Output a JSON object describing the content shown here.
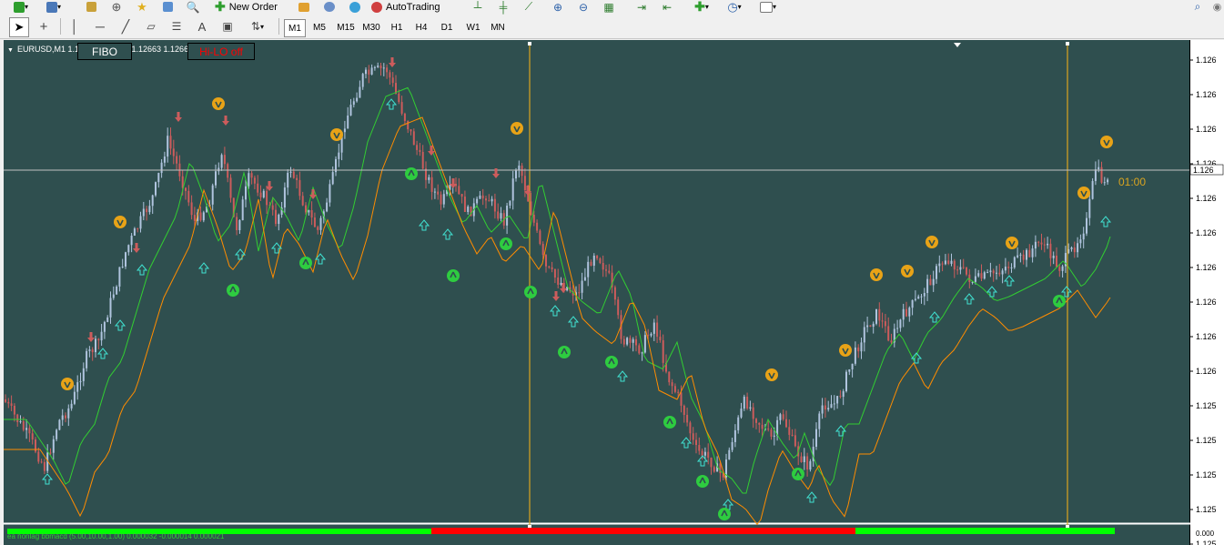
{
  "toolbar_top": {
    "new_order_label": "New Order",
    "autotrading_label": "AutoTrading"
  },
  "timeframes": [
    "M1",
    "M5",
    "M15",
    "M30",
    "H1",
    "H4",
    "D1",
    "W1",
    "MN"
  ],
  "active_timeframe": "M1",
  "chart": {
    "symbol_info": "EURUSD,M1  1.12663 1.12663 1.12663 1.12663",
    "fibo_label": "FIBO",
    "hilo_label": "Hi-LO off",
    "timer_label": "01:00",
    "current_price_label": "1.126",
    "price_axis_labels": [
      "1.126",
      "1.126",
      "1.126",
      "1.126",
      "1.126",
      "1.126",
      "1.126",
      "1.126",
      "1.126",
      "1.126",
      "1.125",
      "1.125",
      "1.125",
      "1.125",
      "1.125"
    ],
    "indicator_label": "ea nonlag bbmacd (5.00,10.00,1.00) 0.000032 -0.000014 0.000021",
    "indicator_axis_label": "0.000",
    "colors": {
      "background": "#2f4f4f",
      "bull_candle": "#b0c4de",
      "bear_candle": "#cd5c5c",
      "fast_ma": "#32cd32",
      "slow_ma": "#ff8c00",
      "vline": "#daa520",
      "hilo_text": "#ff0000",
      "timer_text": "#daa520",
      "indicator_up": "#00ff00",
      "indicator_down": "#ff0000"
    }
  }
}
